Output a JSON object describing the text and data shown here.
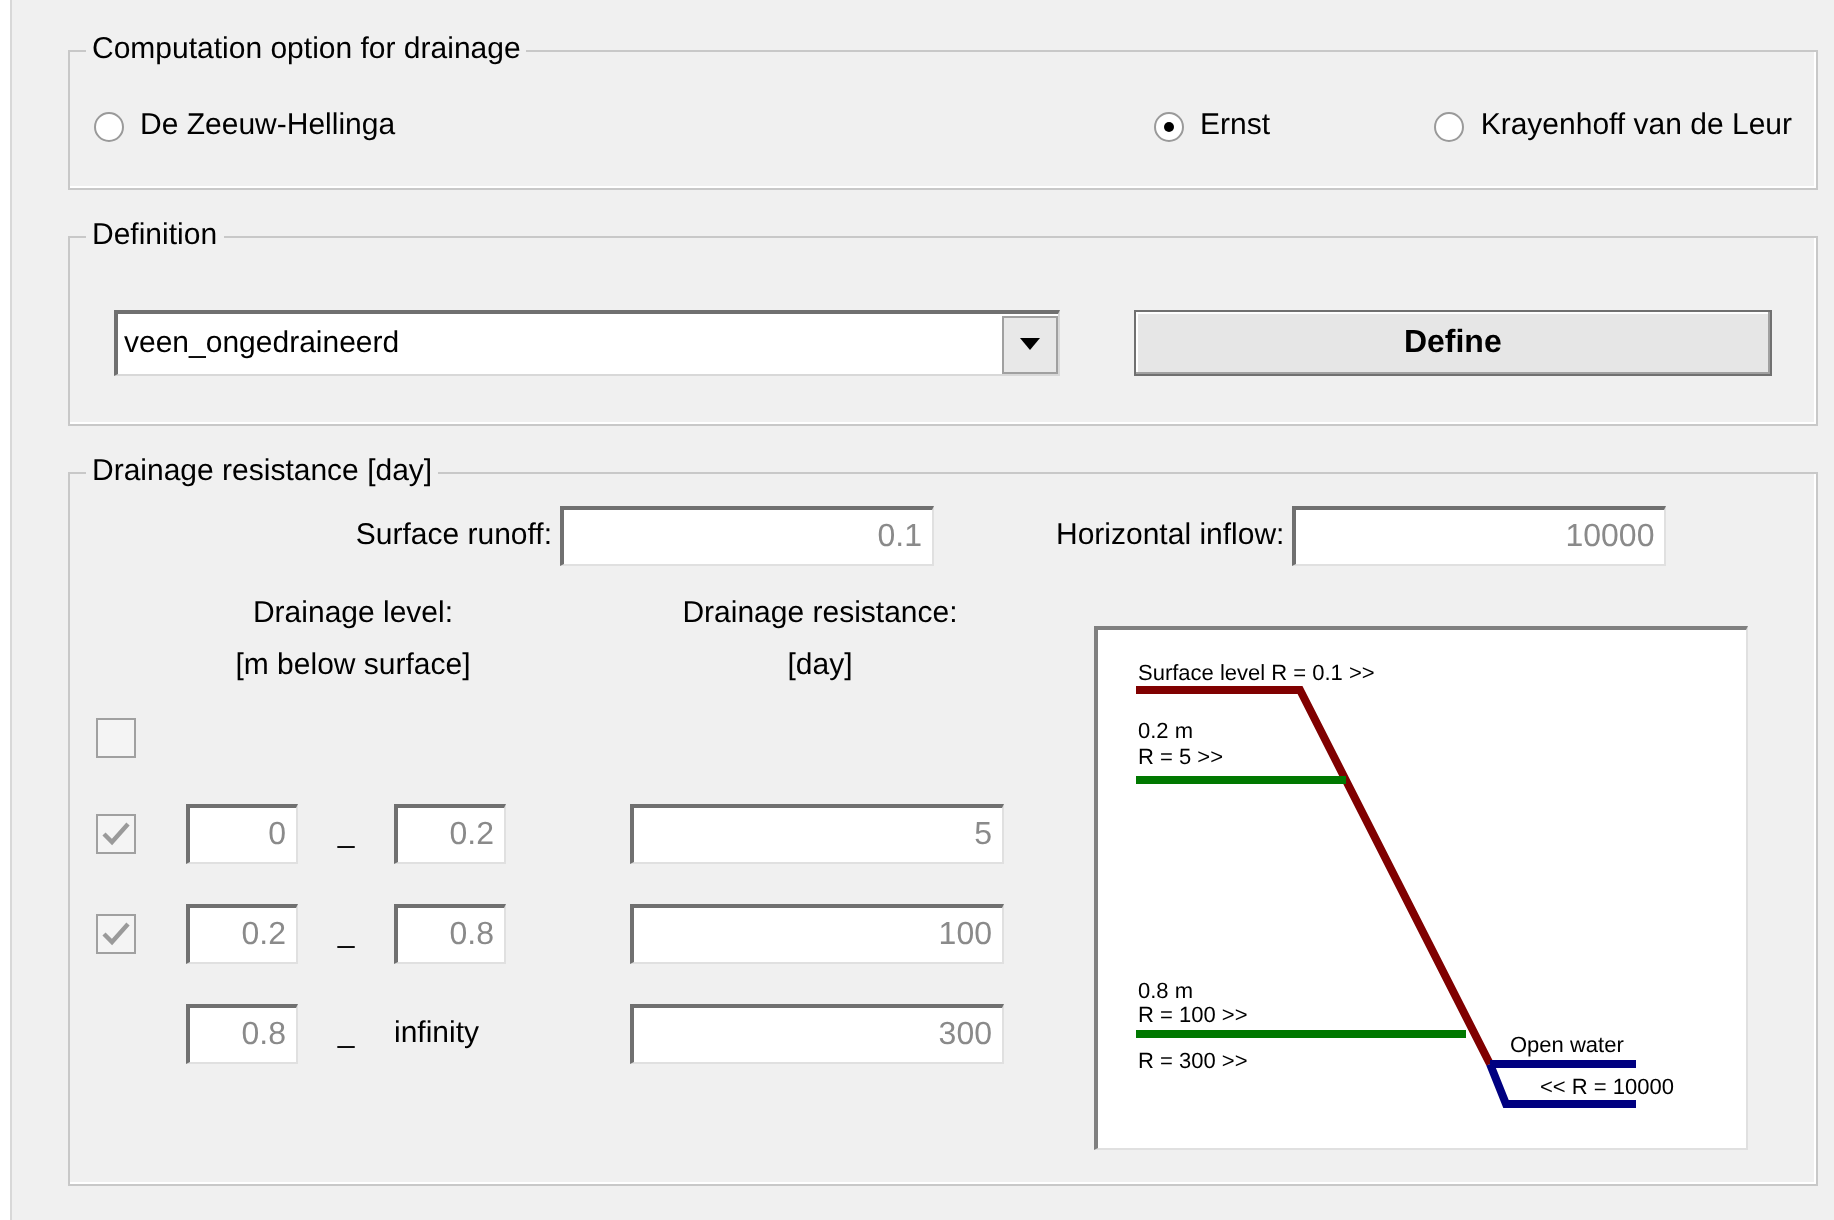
{
  "computation_option": {
    "title": "Computation option for drainage",
    "options": [
      {
        "label": "De Zeeuw-Hellinga",
        "selected": false
      },
      {
        "label": "Ernst",
        "selected": true
      },
      {
        "label": "Krayenhoff van de Leur",
        "selected": false
      }
    ]
  },
  "definition": {
    "title": "Definition",
    "value": "veen_ongedraineerd",
    "button": "Define"
  },
  "drainage_resistance": {
    "title": "Drainage resistance [day]",
    "surface_runoff": {
      "label": "Surface runoff:",
      "value": "0.1"
    },
    "horizontal_inflow": {
      "label": "Horizontal inflow:",
      "value": "10000"
    },
    "level_header": [
      "Drainage level:",
      "[m below surface]"
    ],
    "resistance_header": [
      "Drainage resistance:",
      "[day]"
    ],
    "empty_checkbox": {
      "checked": false
    },
    "rows": [
      {
        "kind": "checkbox",
        "checked": true,
        "from": "0",
        "separator": "_",
        "to": "0.2",
        "resistance": "5"
      },
      {
        "kind": "checkbox",
        "checked": true,
        "from": "0.2",
        "separator": "_",
        "to": "0.8",
        "resistance": "100"
      },
      {
        "kind": "plain",
        "from": "0.8",
        "separator": "_",
        "to": "infinity",
        "resistance": "300"
      }
    ],
    "diagram": {
      "surface_label": "Surface level R = 0.1 >>",
      "level1_depth": "0.2 m",
      "level1_r": "R = 5 >>",
      "level2_depth": "0.8 m",
      "level2_r": "R = 100 >>",
      "level3_r": "R = 300 >>",
      "open_water": "Open water",
      "open_water_r": "<< R = 10000"
    }
  }
}
